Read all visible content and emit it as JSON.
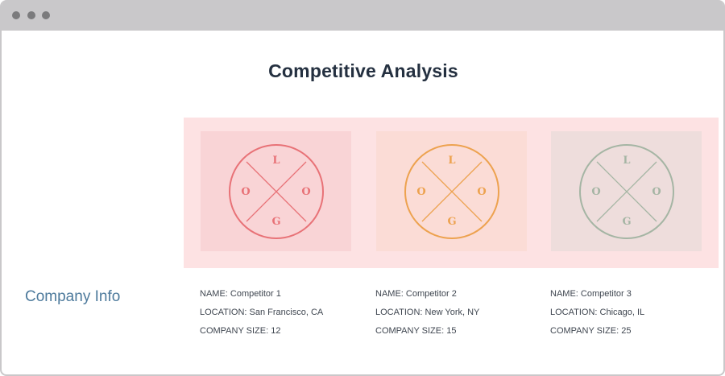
{
  "page": {
    "title": "Competitive Analysis"
  },
  "section": {
    "label": "Company Info"
  },
  "logo_text": [
    "L",
    "O",
    "O",
    "G"
  ],
  "colors": {
    "band_bg": "#fde2e3",
    "card_bgs": [
      "#f9d4d6",
      "#fbdcd6",
      "#eedddc"
    ],
    "logo_strokes": [
      "#e87277",
      "#eda24f",
      "#a5b5a4"
    ]
  },
  "competitors": [
    {
      "name": "NAME: Competitor 1",
      "location": "LOCATION: San Francisco, CA",
      "size": "COMPANY SIZE: 12"
    },
    {
      "name": "NAME: Competitor 2",
      "location": "LOCATION: New York, NY",
      "size": "COMPANY SIZE: 15"
    },
    {
      "name": "NAME: Competitor 3",
      "location": "LOCATION: Chicago, IL",
      "size": "COMPANY SIZE: 25"
    }
  ]
}
